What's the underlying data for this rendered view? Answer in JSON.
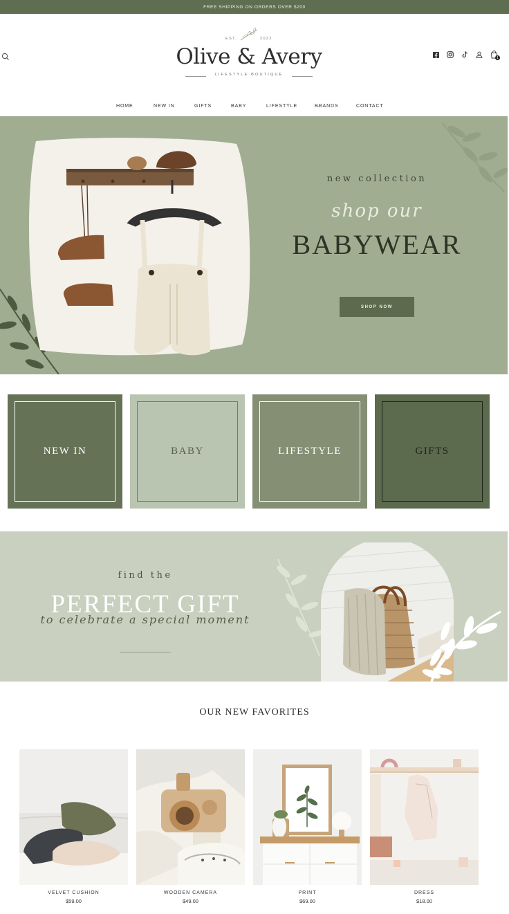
{
  "announcement": "FREE SHIPPING ON ORDERS OVER $200",
  "brand": {
    "est_left": "EST.",
    "est_right": "2022",
    "name": "Olive & Avery",
    "tagline": "LIFESTYLE BOUTIQUE"
  },
  "header_icons": [
    "facebook-icon",
    "instagram-icon",
    "tiktok-icon",
    "account-icon",
    "cart-icon"
  ],
  "cart_count": "1",
  "nav": {
    "home": "HOME",
    "new_in": "NEW IN",
    "gifts": "GIFTS",
    "baby": "BABY",
    "lifestyle": "LIFESTYLE",
    "brands": "BRANDS",
    "contact": "CONTACT"
  },
  "hero": {
    "kicker": "new collection",
    "script": "shop our",
    "headline": "BABYWEAR",
    "cta": "SHOP NOW"
  },
  "categories": [
    {
      "label": "NEW IN",
      "bg": "#667256",
      "border": "#ffffff",
      "text": "#ffffff"
    },
    {
      "label": "BABY",
      "bg": "#bac5b1",
      "border": "#6e7a60",
      "text": "#56604a"
    },
    {
      "label": "LIFESTYLE",
      "bg": "#848f74",
      "border": "#ffffff",
      "text": "#ffffff"
    },
    {
      "label": "GIFTS",
      "bg": "#5c6a4e",
      "border": "#1f241a",
      "text": "#1f241a"
    }
  ],
  "gift_banner": {
    "kicker": "find the",
    "headline": "PERFECT GIFT",
    "script": "to celebrate a special moment"
  },
  "favorites": {
    "title": "OUR NEW FAVORITES",
    "items": [
      {
        "name": "VELVET CUSHION",
        "price": "$59.00"
      },
      {
        "name": "WOODEN CAMERA",
        "price": "$49.00"
      },
      {
        "name": "PRINT",
        "price": "$69.00"
      },
      {
        "name": "DRESS",
        "price": "$18.00"
      }
    ]
  },
  "colors": {
    "brand_green": "#5f6d50",
    "hero_sage": "#a0ad91",
    "banner_sage": "#c9d0bf"
  }
}
